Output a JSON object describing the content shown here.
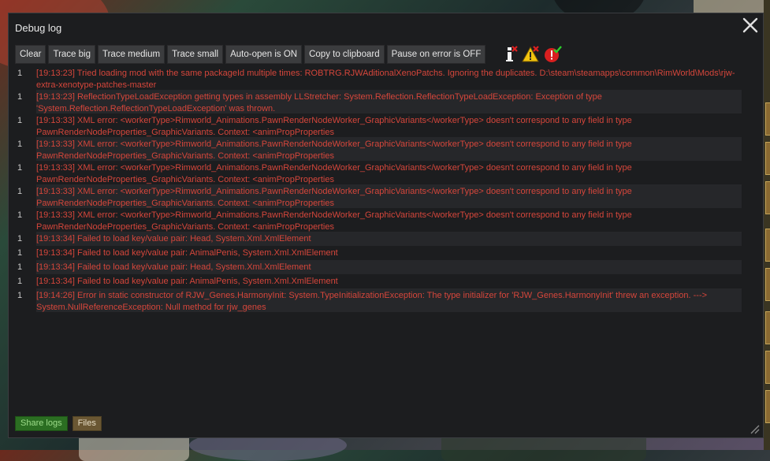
{
  "window": {
    "title": "Debug log"
  },
  "toolbar": {
    "buttons": [
      {
        "label": "Clear"
      },
      {
        "label": "Trace big"
      },
      {
        "label": "Trace medium"
      },
      {
        "label": "Trace small"
      },
      {
        "label": "Auto-open is ON"
      },
      {
        "label": "Copy to clipboard"
      },
      {
        "label": "Pause on error is OFF"
      }
    ],
    "filter_icons": [
      "info-filter-icon",
      "warning-filter-icon",
      "error-filter-icon"
    ]
  },
  "log": {
    "entries": [
      {
        "count": "1",
        "text": "[19:13:23] Tried loading mod with the same packageId multiple times: ROBTRG.RJWAditionalXenoPatchs. Ignoring the duplicates. D:\\steam\\steamapps\\common\\RimWorld\\Mods\\rjw-extra-xenotype-patches-master"
      },
      {
        "count": "1",
        "text": "[19:13:23] ReflectionTypeLoadException getting types in assembly LLStretcher: System.Reflection.ReflectionTypeLoadException: Exception of type 'System.Reflection.ReflectionTypeLoadException' was thrown."
      },
      {
        "count": "1",
        "text": "[19:13:33] XML error: <workerType>Rimworld_Animations.PawnRenderNodeWorker_GraphicVariants</workerType> doesn't correspond to any field in type PawnRenderNodeProperties_GraphicVariants. Context: <animPropProperties"
      },
      {
        "count": "1",
        "text": "[19:13:33] XML error: <workerType>Rimworld_Animations.PawnRenderNodeWorker_GraphicVariants</workerType> doesn't correspond to any field in type PawnRenderNodeProperties_GraphicVariants. Context: <animPropProperties"
      },
      {
        "count": "1",
        "text": "[19:13:33] XML error: <workerType>Rimworld_Animations.PawnRenderNodeWorker_GraphicVariants</workerType> doesn't correspond to any field in type PawnRenderNodeProperties_GraphicVariants. Context: <animPropProperties"
      },
      {
        "count": "1",
        "text": "[19:13:33] XML error: <workerType>Rimworld_Animations.PawnRenderNodeWorker_GraphicVariants</workerType> doesn't correspond to any field in type PawnRenderNodeProperties_GraphicVariants. Context: <animPropProperties"
      },
      {
        "count": "1",
        "text": "[19:13:33] XML error: <workerType>Rimworld_Animations.PawnRenderNodeWorker_GraphicVariants</workerType> doesn't correspond to any field in type PawnRenderNodeProperties_GraphicVariants. Context: <animPropProperties"
      },
      {
        "count": "1",
        "text": "[19:13:34] Failed to load key/value pair: Head, System.Xml.XmlElement"
      },
      {
        "count": "1",
        "text": "[19:13:34] Failed to load key/value pair: AnimalPenis, System.Xml.XmlElement"
      },
      {
        "count": "1",
        "text": "[19:13:34] Failed to load key/value pair: Head, System.Xml.XmlElement"
      },
      {
        "count": "1",
        "text": "[19:13:34] Failed to load key/value pair: AnimalPenis, System.Xml.XmlElement"
      },
      {
        "count": "1",
        "text": "[19:14:26] Error in static constructor of RJW_Genes.HarmonyInit: System.TypeInitializationException: The type initializer for 'RJW_Genes.HarmonyInit' threw an exception. ---> System.NullReferenceException: Null method for rjw_genes"
      }
    ]
  },
  "footer": {
    "share_label": "Share logs",
    "files_label": "Files"
  },
  "colors": {
    "error_text": "#d5463b",
    "window_bg": "#1c1d1f",
    "button_bg": "#3b3c3e",
    "share_bg": "#2b6e22",
    "files_bg": "#6a5733"
  }
}
